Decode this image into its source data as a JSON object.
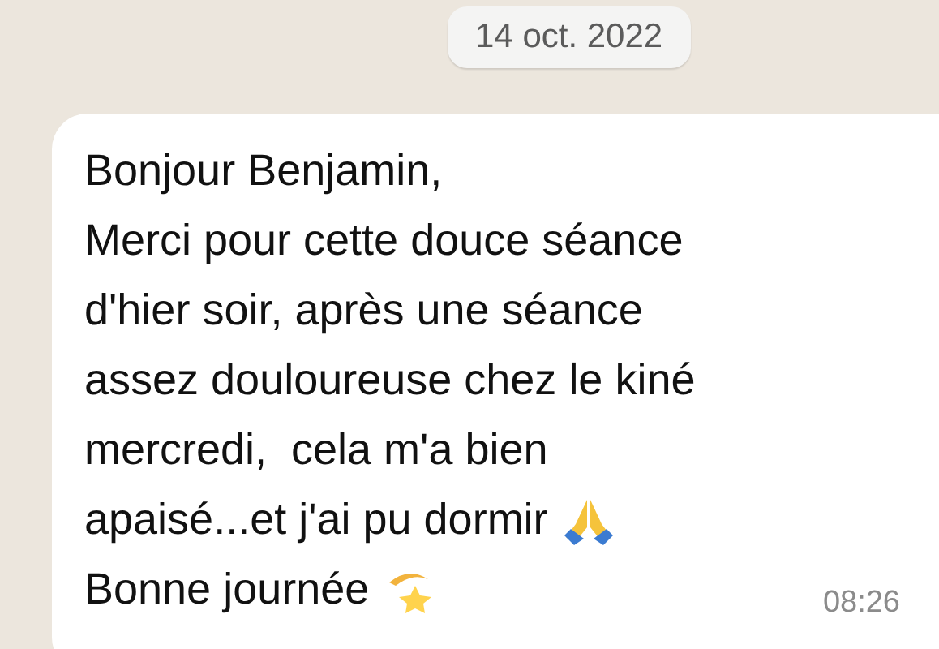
{
  "date_separator": "14 oct. 2022",
  "message": {
    "lines": [
      {
        "text": "Bonjour Benjamin,",
        "kind": "plain"
      },
      {
        "text": "Merci pour cette douce séance",
        "kind": "plain"
      },
      {
        "text": "d'hier soir, après une séance",
        "kind": "plain"
      },
      {
        "text": "assez douloureuse chez le kiné",
        "kind": "plain"
      },
      {
        "text": "mercredi,  cela m'a bien",
        "kind": "plain"
      },
      {
        "text": "apaisé...et j'ai pu dormir",
        "kind": "pray"
      },
      {
        "text": "Bonne journée",
        "kind": "dizzy"
      }
    ],
    "time": "08:26"
  }
}
